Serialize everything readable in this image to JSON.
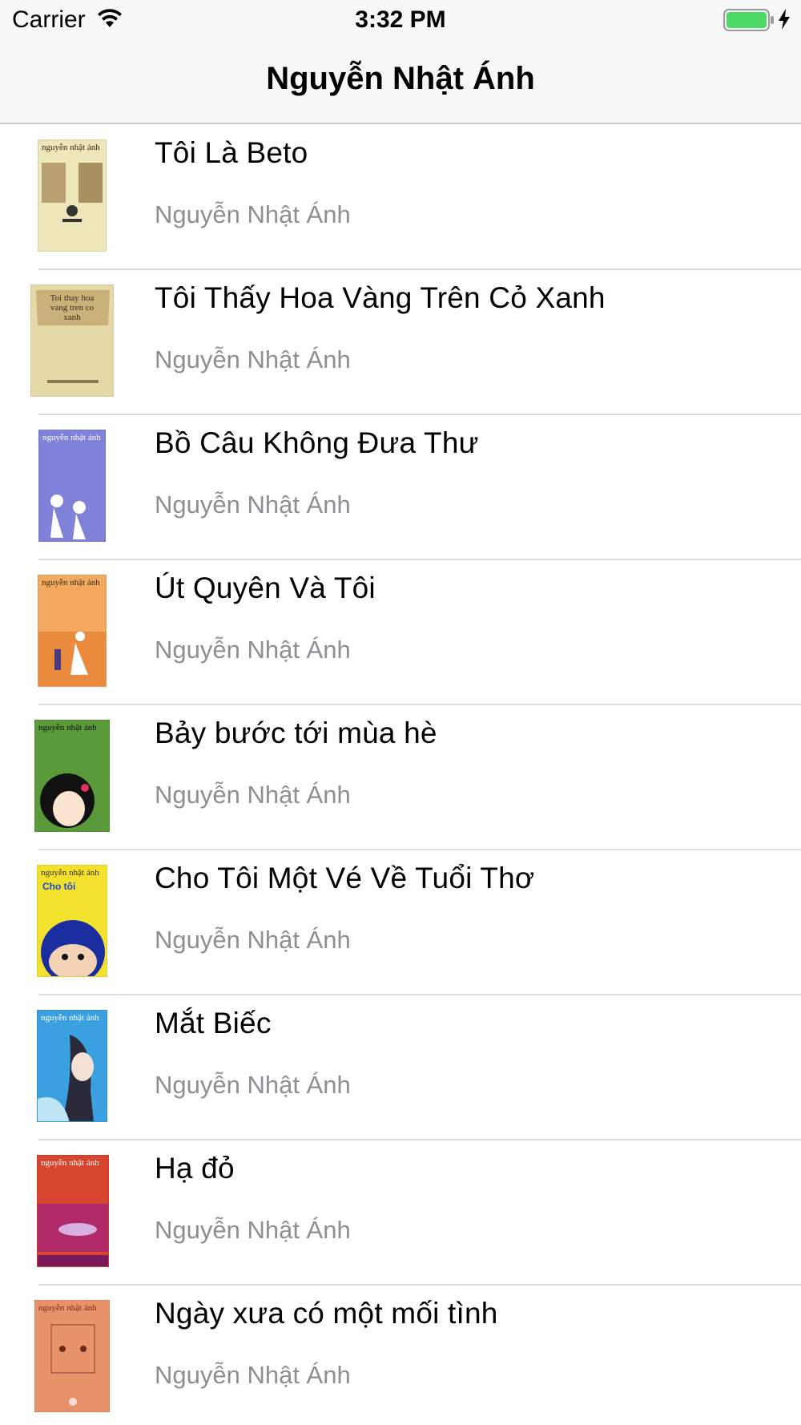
{
  "status_bar": {
    "carrier": "Carrier",
    "time": "3:32 PM",
    "icons": [
      "wifi-icon",
      "battery-icon",
      "charging-bolt-icon"
    ]
  },
  "nav": {
    "title": "Nguyễn Nhật Ánh"
  },
  "books": [
    {
      "title": "Tôi Là Beto",
      "author": "Nguyễn Nhật Ánh",
      "cover_caption": "nguyễn nhật ánh",
      "cover_color": "#e9e2b0"
    },
    {
      "title": "Tôi Thấy Hoa Vàng Trên Cỏ Xanh",
      "author": "Nguyễn Nhật Ánh",
      "cover_caption": "Toi thay hoa vang tren co xanh",
      "cover_color": "#e6d9a8"
    },
    {
      "title": "Bồ Câu Không Đưa Thư",
      "author": "Nguyễn Nhật Ánh",
      "cover_caption": "nguyễn nhật ánh",
      "cover_color": "#7d7fd6"
    },
    {
      "title": "Út Quyên Và Tôi",
      "author": "Nguyễn Nhật Ánh",
      "cover_caption": "nguyễn nhật ánh",
      "cover_color": "#f2a65a"
    },
    {
      "title": "Bảy bước tới mùa hè",
      "author": "Nguyễn Nhật Ánh",
      "cover_caption": "nguyễn nhật ánh",
      "cover_color": "#5a9a3a"
    },
    {
      "title": "Cho Tôi Một Vé Về Tuổi Thơ",
      "author": "Nguyễn Nhật Ánh",
      "cover_caption": "nguyễn nhật ánh",
      "cover_color": "#f2e22e"
    },
    {
      "title": "Mắt Biếc",
      "author": "Nguyễn Nhật Ánh",
      "cover_caption": "nguyễn nhật ánh",
      "cover_color": "#3aa0e0"
    },
    {
      "title": "Hạ đỏ",
      "author": "Nguyễn Nhật Ánh",
      "cover_caption": "nguyễn nhật ánh",
      "cover_color": "#d8452e"
    },
    {
      "title": "Ngày xưa có một mối tình",
      "author": "Nguyễn Nhật Ánh",
      "cover_caption": "nguyễn nhật ánh",
      "cover_color": "#e8926a"
    }
  ]
}
